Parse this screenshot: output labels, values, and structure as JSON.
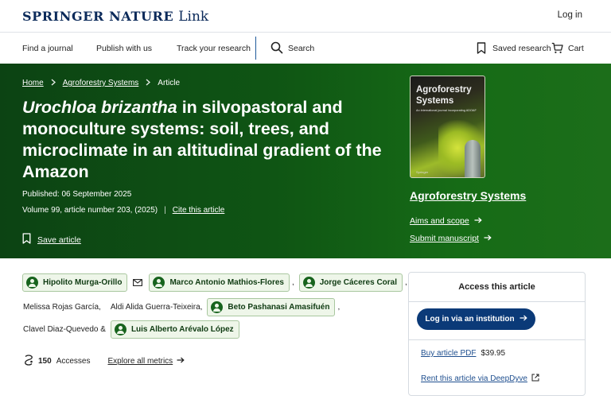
{
  "header": {
    "brand_main": "SPRINGER NATURE",
    "brand_sub": "Link",
    "login_label": "Log in"
  },
  "nav": {
    "find_journal": "Find a journal",
    "publish": "Publish with us",
    "track": "Track your research",
    "search": "Search",
    "saved": "Saved research",
    "cart": "Cart"
  },
  "breadcrumb": {
    "home": "Home",
    "journal": "Agroforestry Systems",
    "current": "Article"
  },
  "article": {
    "title_italic": "Urochloa brizantha",
    "title_rest": " in silvopastoral and monoculture systems: soil, trees, and microclimate in an altitudinal gradient of the Amazon",
    "published": "Published: 06 September 2025",
    "volume": "Volume 99, article number 203, (2025)",
    "cite_label": "Cite this article",
    "save_label": "Save article"
  },
  "journal_panel": {
    "cover_title_line1": "Agroforestry",
    "cover_title_line2": "Systems",
    "cover_subtitle": "An international journal incorporating ADOAF",
    "cover_logo": "Springer",
    "name": "Agroforestry Systems",
    "aims": "Aims and scope",
    "submit": "Submit manuscript"
  },
  "authors": {
    "a1": "Hipolito Murga-Orillo",
    "a2": "Marco Antonio Mathios-Flores",
    "a3": "Jorge Cáceres Coral",
    "a4": "Melissa Rojas García,",
    "a5": "Aldi Alida Guerra-Teixeira,",
    "a6": "Beto Pashanasi Amasifuén",
    "a7": "Clavel Diaz-Quevedo &",
    "a8": "Luis Alberto Arévalo López",
    "comma": ","
  },
  "metrics": {
    "accesses_count": "150",
    "accesses_label": "Accesses",
    "explore": "Explore all metrics"
  },
  "access": {
    "heading": "Access this article",
    "institution_button": "Log in via an institution",
    "buy_label": "Buy article PDF",
    "price": "$39.95",
    "rent_label": "Rent this article via DeepDyve"
  },
  "colors": {
    "brand_navy": "#0b2a5a",
    "hero_green": "#0f5514",
    "chip_bg": "#eef6e9",
    "button_blue": "#0b3a78"
  }
}
